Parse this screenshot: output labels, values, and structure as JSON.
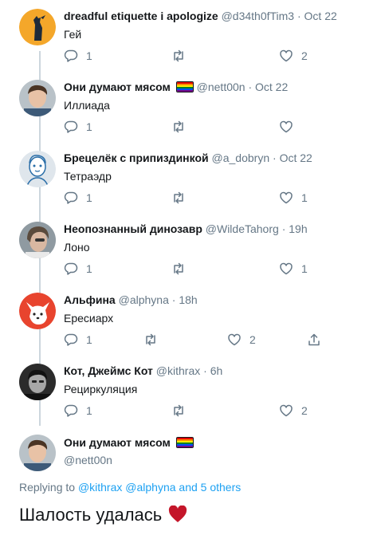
{
  "colors": {
    "text": "#14171a",
    "muted": "#657786",
    "link": "#1da1f2",
    "thread_line": "#ccd6dd",
    "heart": "#c4162a"
  },
  "tweets": [
    {
      "name": "dreadful etiquette i apologize",
      "handle": "@d34th0fTim3",
      "time": "Oct 22",
      "text": "Гей",
      "reply_count": "1",
      "retweet_count": "",
      "like_count": "2",
      "flag": false
    },
    {
      "name": "Они думают мясом",
      "handle": "@nett00n",
      "time": "Oct 22",
      "text": "Иллиада",
      "reply_count": "1",
      "retweet_count": "",
      "like_count": "",
      "flag": true
    },
    {
      "name": "Брецелёк с припиздинкой",
      "handle": "@a_dobryn",
      "time": "Oct 22",
      "text": "Тетраэдр",
      "reply_count": "1",
      "retweet_count": "",
      "like_count": "1",
      "flag": false
    },
    {
      "name": "Неопознанный динозавр",
      "handle": "@WildeTahorg",
      "time": "19h",
      "text": "Лоно",
      "reply_count": "1",
      "retweet_count": "",
      "like_count": "1",
      "flag": false
    },
    {
      "name": "Альфина",
      "handle": "@alphyna",
      "time": "18h",
      "text": "Ересиарх",
      "reply_count": "1",
      "retweet_count": "",
      "like_count": "2",
      "flag": false,
      "share_icon": "share-icon"
    },
    {
      "name": "Кот, Джеймс Кот",
      "handle": "@kithrax",
      "time": "6h",
      "text": "Рециркуляция",
      "reply_count": "1",
      "retweet_count": "",
      "like_count": "2",
      "flag": false
    }
  ],
  "main_tweet": {
    "name": "Они думают мясом",
    "handle": "@nett00n",
    "flag": true,
    "replying_prefix": "Replying to",
    "replying_users": "@kithrax @alphyna",
    "replying_others": "and 5 others",
    "text": "Шалость удалась",
    "emoji": "red-heart-emoji"
  },
  "icons": {
    "reply": "reply-icon",
    "retweet": "retweet-icon",
    "like": "heart-icon",
    "share": "share-icon",
    "flag": "rainbow-flag-emoji"
  },
  "flag_colors": [
    "#e40303",
    "#ff8c00",
    "#ffed00",
    "#008026",
    "#004dff",
    "#750787"
  ]
}
